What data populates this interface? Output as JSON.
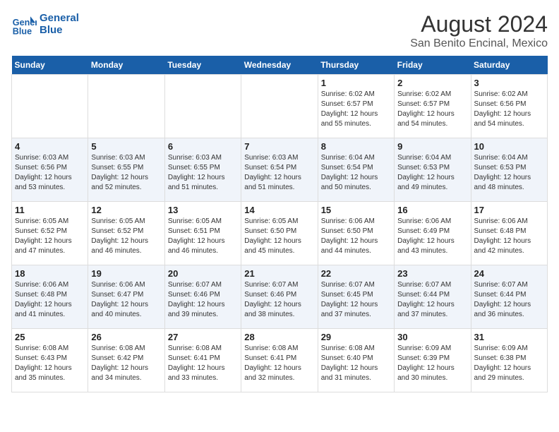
{
  "header": {
    "logo_line1": "General",
    "logo_line2": "Blue",
    "title": "August 2024",
    "subtitle": "San Benito Encinal, Mexico"
  },
  "days_of_week": [
    "Sunday",
    "Monday",
    "Tuesday",
    "Wednesday",
    "Thursday",
    "Friday",
    "Saturday"
  ],
  "weeks": [
    [
      {
        "num": "",
        "info": ""
      },
      {
        "num": "",
        "info": ""
      },
      {
        "num": "",
        "info": ""
      },
      {
        "num": "",
        "info": ""
      },
      {
        "num": "1",
        "info": "Sunrise: 6:02 AM\nSunset: 6:57 PM\nDaylight: 12 hours\nand 55 minutes."
      },
      {
        "num": "2",
        "info": "Sunrise: 6:02 AM\nSunset: 6:57 PM\nDaylight: 12 hours\nand 54 minutes."
      },
      {
        "num": "3",
        "info": "Sunrise: 6:02 AM\nSunset: 6:56 PM\nDaylight: 12 hours\nand 54 minutes."
      }
    ],
    [
      {
        "num": "4",
        "info": "Sunrise: 6:03 AM\nSunset: 6:56 PM\nDaylight: 12 hours\nand 53 minutes."
      },
      {
        "num": "5",
        "info": "Sunrise: 6:03 AM\nSunset: 6:55 PM\nDaylight: 12 hours\nand 52 minutes."
      },
      {
        "num": "6",
        "info": "Sunrise: 6:03 AM\nSunset: 6:55 PM\nDaylight: 12 hours\nand 51 minutes."
      },
      {
        "num": "7",
        "info": "Sunrise: 6:03 AM\nSunset: 6:54 PM\nDaylight: 12 hours\nand 51 minutes."
      },
      {
        "num": "8",
        "info": "Sunrise: 6:04 AM\nSunset: 6:54 PM\nDaylight: 12 hours\nand 50 minutes."
      },
      {
        "num": "9",
        "info": "Sunrise: 6:04 AM\nSunset: 6:53 PM\nDaylight: 12 hours\nand 49 minutes."
      },
      {
        "num": "10",
        "info": "Sunrise: 6:04 AM\nSunset: 6:53 PM\nDaylight: 12 hours\nand 48 minutes."
      }
    ],
    [
      {
        "num": "11",
        "info": "Sunrise: 6:05 AM\nSunset: 6:52 PM\nDaylight: 12 hours\nand 47 minutes."
      },
      {
        "num": "12",
        "info": "Sunrise: 6:05 AM\nSunset: 6:52 PM\nDaylight: 12 hours\nand 46 minutes."
      },
      {
        "num": "13",
        "info": "Sunrise: 6:05 AM\nSunset: 6:51 PM\nDaylight: 12 hours\nand 46 minutes."
      },
      {
        "num": "14",
        "info": "Sunrise: 6:05 AM\nSunset: 6:50 PM\nDaylight: 12 hours\nand 45 minutes."
      },
      {
        "num": "15",
        "info": "Sunrise: 6:06 AM\nSunset: 6:50 PM\nDaylight: 12 hours\nand 44 minutes."
      },
      {
        "num": "16",
        "info": "Sunrise: 6:06 AM\nSunset: 6:49 PM\nDaylight: 12 hours\nand 43 minutes."
      },
      {
        "num": "17",
        "info": "Sunrise: 6:06 AM\nSunset: 6:48 PM\nDaylight: 12 hours\nand 42 minutes."
      }
    ],
    [
      {
        "num": "18",
        "info": "Sunrise: 6:06 AM\nSunset: 6:48 PM\nDaylight: 12 hours\nand 41 minutes."
      },
      {
        "num": "19",
        "info": "Sunrise: 6:06 AM\nSunset: 6:47 PM\nDaylight: 12 hours\nand 40 minutes."
      },
      {
        "num": "20",
        "info": "Sunrise: 6:07 AM\nSunset: 6:46 PM\nDaylight: 12 hours\nand 39 minutes."
      },
      {
        "num": "21",
        "info": "Sunrise: 6:07 AM\nSunset: 6:46 PM\nDaylight: 12 hours\nand 38 minutes."
      },
      {
        "num": "22",
        "info": "Sunrise: 6:07 AM\nSunset: 6:45 PM\nDaylight: 12 hours\nand 37 minutes."
      },
      {
        "num": "23",
        "info": "Sunrise: 6:07 AM\nSunset: 6:44 PM\nDaylight: 12 hours\nand 37 minutes."
      },
      {
        "num": "24",
        "info": "Sunrise: 6:07 AM\nSunset: 6:44 PM\nDaylight: 12 hours\nand 36 minutes."
      }
    ],
    [
      {
        "num": "25",
        "info": "Sunrise: 6:08 AM\nSunset: 6:43 PM\nDaylight: 12 hours\nand 35 minutes."
      },
      {
        "num": "26",
        "info": "Sunrise: 6:08 AM\nSunset: 6:42 PM\nDaylight: 12 hours\nand 34 minutes."
      },
      {
        "num": "27",
        "info": "Sunrise: 6:08 AM\nSunset: 6:41 PM\nDaylight: 12 hours\nand 33 minutes."
      },
      {
        "num": "28",
        "info": "Sunrise: 6:08 AM\nSunset: 6:41 PM\nDaylight: 12 hours\nand 32 minutes."
      },
      {
        "num": "29",
        "info": "Sunrise: 6:08 AM\nSunset: 6:40 PM\nDaylight: 12 hours\nand 31 minutes."
      },
      {
        "num": "30",
        "info": "Sunrise: 6:09 AM\nSunset: 6:39 PM\nDaylight: 12 hours\nand 30 minutes."
      },
      {
        "num": "31",
        "info": "Sunrise: 6:09 AM\nSunset: 6:38 PM\nDaylight: 12 hours\nand 29 minutes."
      }
    ]
  ]
}
